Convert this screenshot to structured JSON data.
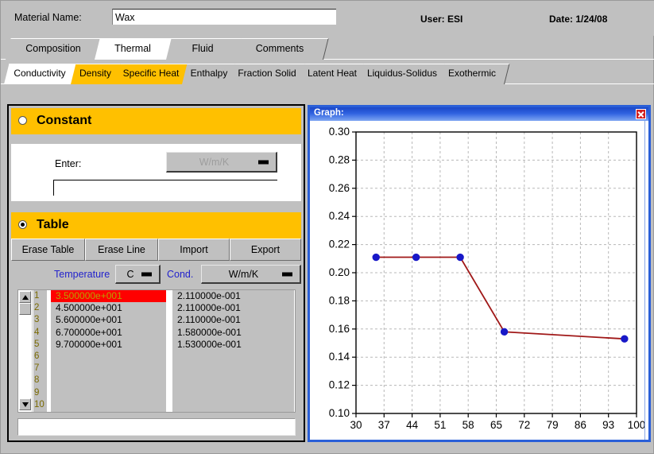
{
  "header": {
    "material_label": "Material Name:",
    "material_value": "Wax",
    "user_label": "User:  ESI",
    "date_label": "Date:  1/24/08"
  },
  "tabs_main": [
    {
      "label": "Composition",
      "state": "normal"
    },
    {
      "label": "Thermal",
      "state": "active"
    },
    {
      "label": "Fluid",
      "state": "normal"
    },
    {
      "label": "Comments",
      "state": "normal"
    }
  ],
  "tabs_sub": [
    {
      "label": "Conductivity",
      "state": "active"
    },
    {
      "label": "Density",
      "state": "highlight"
    },
    {
      "label": "Specific Heat",
      "state": "highlight"
    },
    {
      "label": "Enthalpy",
      "state": "normal"
    },
    {
      "label": "Fraction Solid",
      "state": "normal"
    },
    {
      "label": "Latent Heat",
      "state": "normal"
    },
    {
      "label": "Liquidus-Solidus",
      "state": "normal"
    },
    {
      "label": "Exothermic",
      "state": "normal"
    }
  ],
  "constant": {
    "title": "Constant",
    "selected": false,
    "enter_label": "Enter:",
    "unit_value": "W/m/K",
    "unit_disabled": true,
    "value": ""
  },
  "table_section": {
    "title": "Table",
    "selected": true,
    "buttons": [
      "Erase Table",
      "Erase Line",
      "Import",
      "Export"
    ],
    "col1_label": "Temperature",
    "col1_unit": "C",
    "col2_label": "Cond.",
    "col2_unit": "W/m/K",
    "row_numbers": [
      "1",
      "2",
      "3",
      "4",
      "5",
      "6",
      "7",
      "8",
      "9",
      "10"
    ],
    "rows": [
      {
        "temperature": "3.500000e+001",
        "conductivity": "2.110000e-001",
        "selected": true
      },
      {
        "temperature": "4.500000e+001",
        "conductivity": "2.110000e-001",
        "selected": false
      },
      {
        "temperature": "5.600000e+001",
        "conductivity": "2.110000e-001",
        "selected": false
      },
      {
        "temperature": "6.700000e+001",
        "conductivity": "1.580000e-001",
        "selected": false
      },
      {
        "temperature": "9.700000e+001",
        "conductivity": "1.530000e-001",
        "selected": false
      }
    ],
    "status_value": ""
  },
  "graph_window": {
    "title": "Graph:",
    "close_icon": "close-icon"
  },
  "chart_data": {
    "type": "line",
    "title": "",
    "xlabel": "",
    "ylabel": "",
    "x": [
      35,
      45,
      56,
      67,
      97
    ],
    "y": [
      0.211,
      0.211,
      0.211,
      0.158,
      0.153
    ],
    "xlim": [
      30,
      100
    ],
    "ylim": [
      0.1,
      0.3
    ],
    "xticks": [
      30,
      37,
      44,
      51,
      58,
      65,
      72,
      79,
      86,
      93,
      100
    ],
    "yticks": [
      0.1,
      0.12,
      0.14,
      0.16,
      0.18,
      0.2,
      0.22,
      0.24,
      0.26,
      0.28,
      0.3
    ],
    "ytick_labels": [
      "0.10",
      "0.12",
      "0.14",
      "0.16",
      "0.18",
      "0.20",
      "0.22",
      "0.24",
      "0.26",
      "0.28",
      "0.30"
    ],
    "xtick_labels": [
      "30",
      "37",
      "44",
      "51",
      "58",
      "65",
      "72",
      "79",
      "86",
      "93",
      "100"
    ],
    "grid": true,
    "line_color": "#a01818",
    "marker_color": "#1818c8",
    "legend": null
  }
}
